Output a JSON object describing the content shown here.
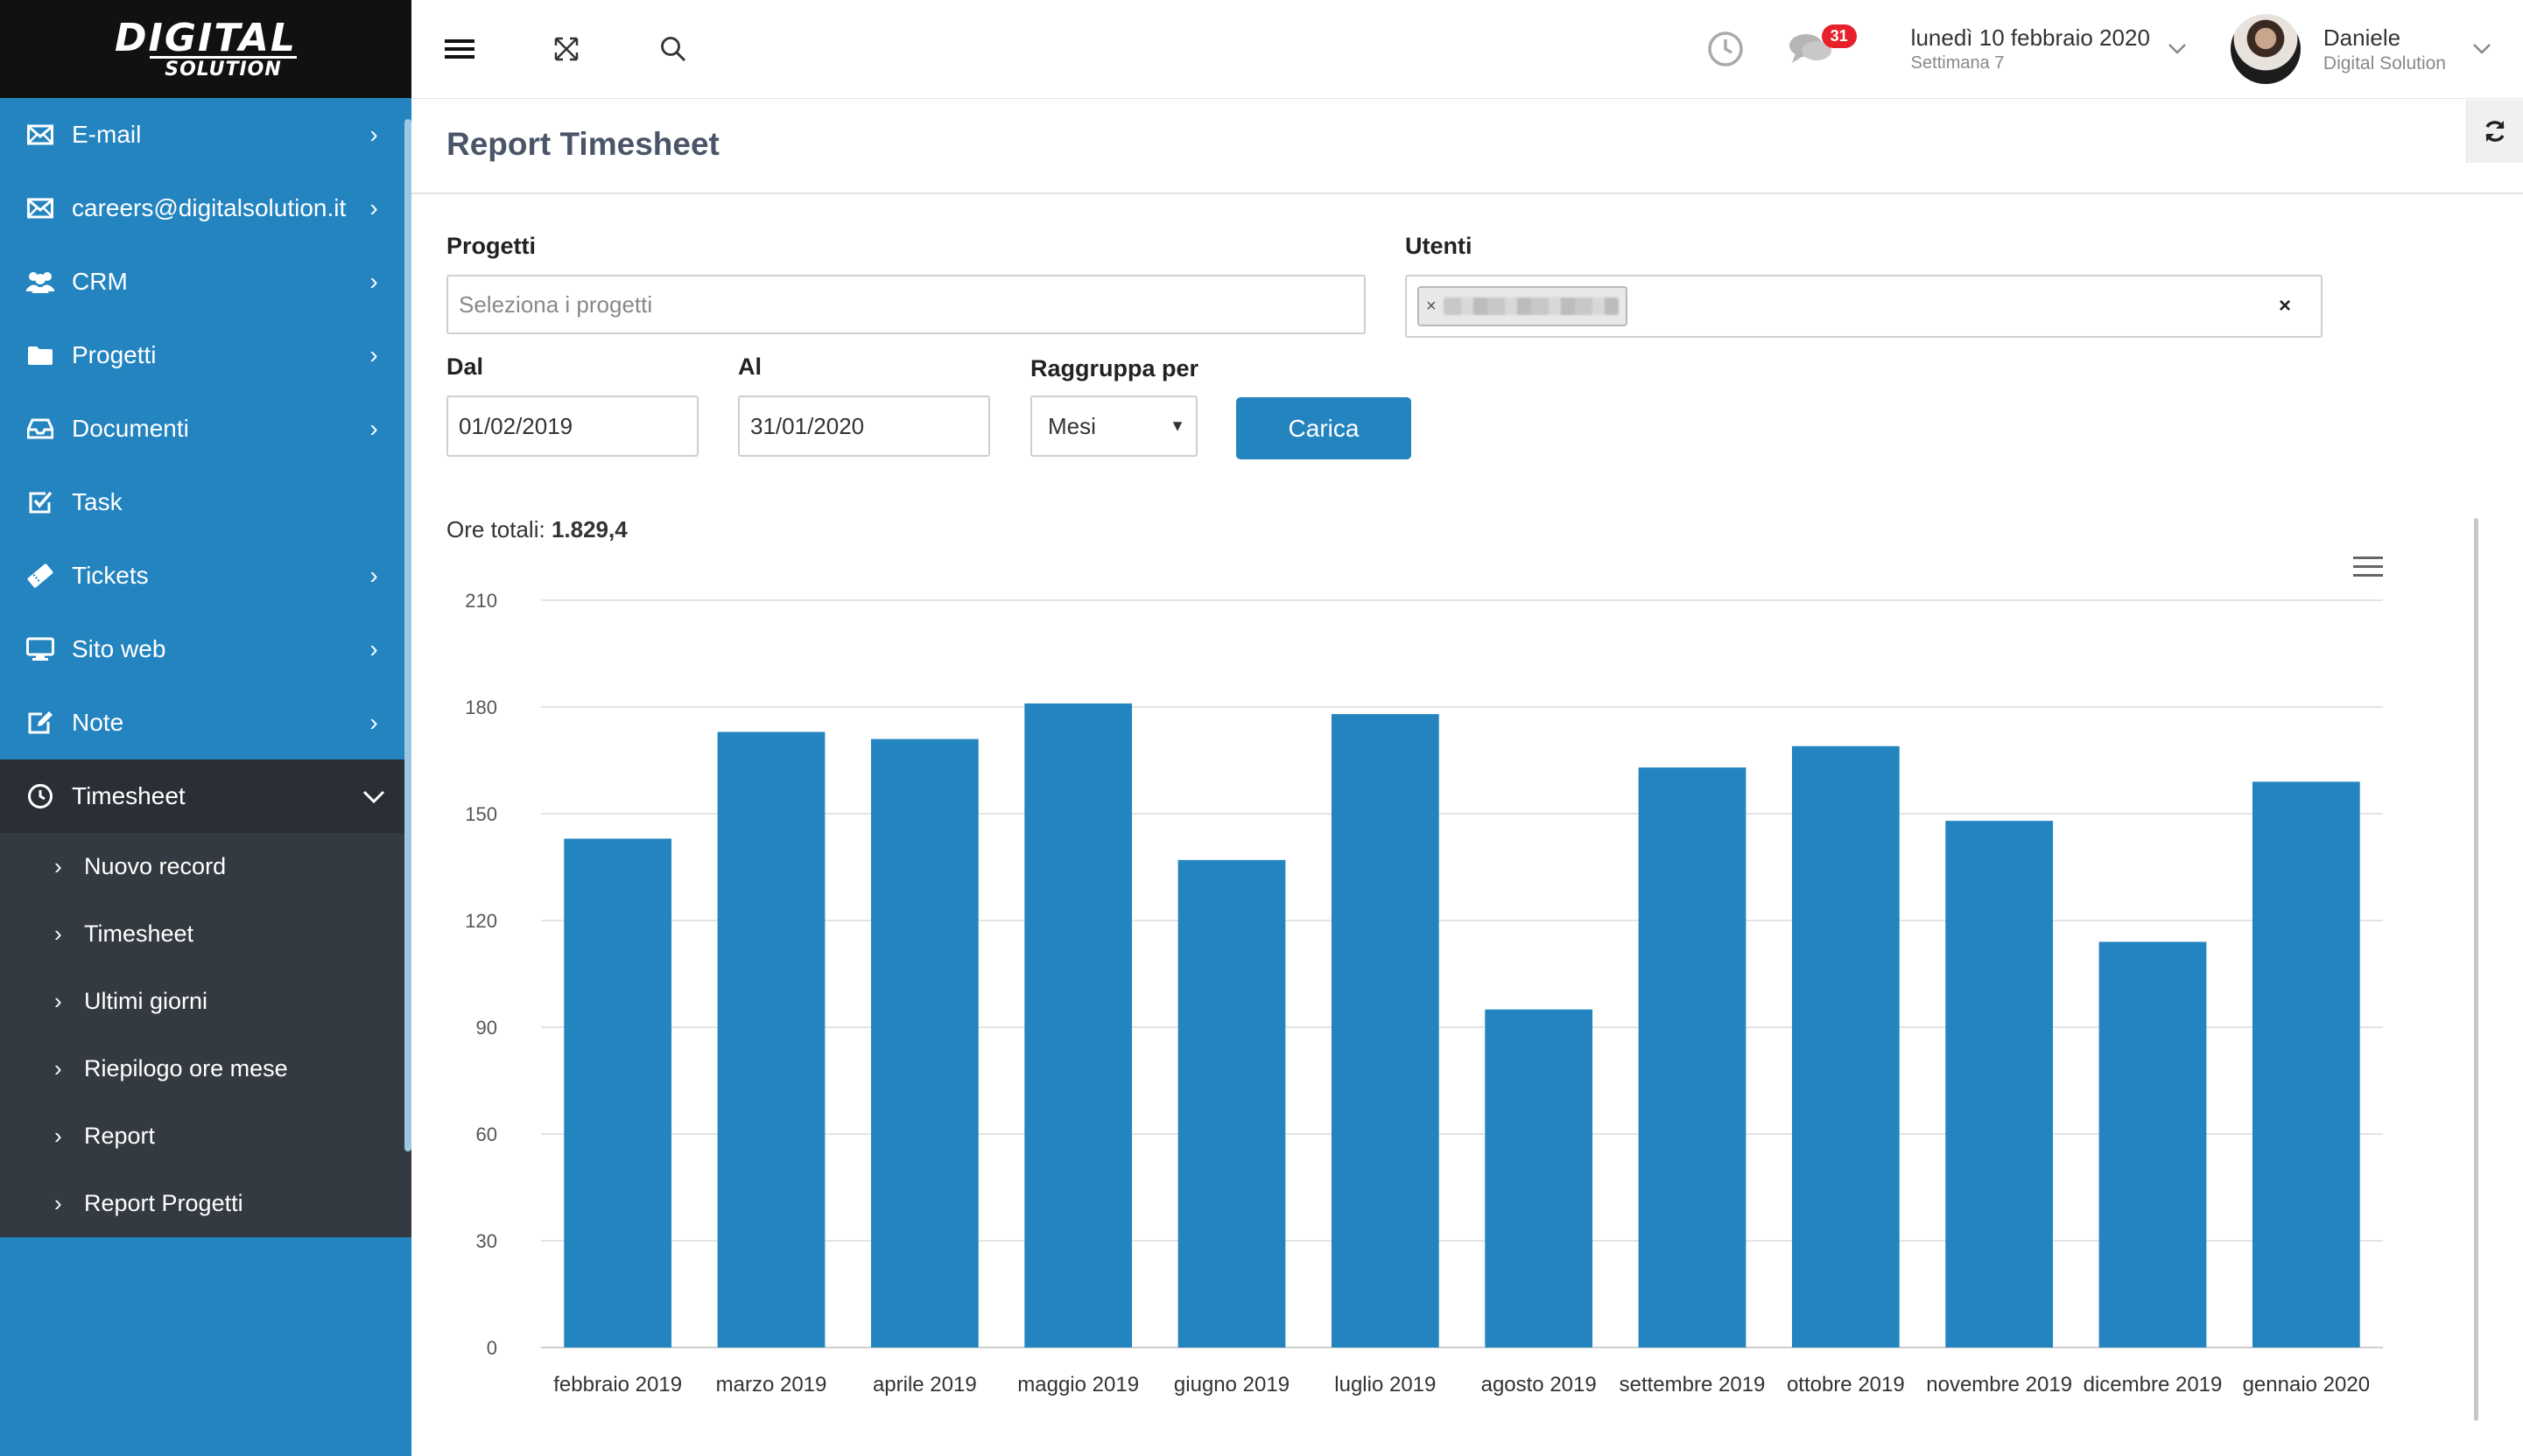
{
  "brand": {
    "logo_line1": "DIGITAL",
    "logo_line2": "SOLUTION"
  },
  "sidebar": {
    "items": [
      {
        "label": "E-mail",
        "icon": "envelope-icon"
      },
      {
        "label": "careers@digitalsolution.it",
        "icon": "envelope-icon"
      },
      {
        "label": "CRM",
        "icon": "users-icon"
      },
      {
        "label": "Progetti",
        "icon": "folder-icon"
      },
      {
        "label": "Documenti",
        "icon": "inbox-icon"
      },
      {
        "label": "Task",
        "icon": "checkbox-icon"
      },
      {
        "label": "Tickets",
        "icon": "ticket-icon"
      },
      {
        "label": "Sito web",
        "icon": "monitor-icon"
      },
      {
        "label": "Note",
        "icon": "edit-icon"
      },
      {
        "label": "Timesheet",
        "icon": "clock-icon"
      }
    ],
    "submenu": [
      {
        "label": "Nuovo record"
      },
      {
        "label": "Timesheet"
      },
      {
        "label": "Ultimi giorni"
      },
      {
        "label": "Riepilogo ore mese"
      },
      {
        "label": "Report"
      },
      {
        "label": "Report Progetti"
      }
    ]
  },
  "topbar": {
    "notifications_count": "31",
    "date": "lunedì 10 febbraio 2020",
    "week": "Settimana 7",
    "user_name": "Daniele",
    "user_company": "Digital Solution"
  },
  "page": {
    "title": "Report Timesheet"
  },
  "form": {
    "progetti_label": "Progetti",
    "progetti_placeholder": "Seleziona i progetti",
    "utenti_label": "Utenti",
    "dal_label": "Dal",
    "dal_value": "01/02/2019",
    "al_label": "Al",
    "al_value": "31/01/2020",
    "raggruppa_label": "Raggruppa per",
    "raggruppa_value": "Mesi",
    "submit_label": "Carica"
  },
  "summary": {
    "label": "Ore totali:",
    "value": "1.829,4"
  },
  "colors": {
    "sidebar": "#2384c0",
    "sidebar_active": "#2a2f36",
    "submenu": "#343a41",
    "bar": "#2384c0",
    "badge": "#e8202a"
  },
  "chart_data": {
    "type": "bar",
    "categories": [
      "febbraio 2019",
      "marzo 2019",
      "aprile 2019",
      "maggio 2019",
      "giugno 2019",
      "luglio 2019",
      "agosto 2019",
      "settembre 2019",
      "ottobre 2019",
      "novembre 2019",
      "dicembre 2019",
      "gennaio 2020"
    ],
    "values": [
      143,
      173,
      171,
      181,
      137,
      178,
      95,
      163,
      169,
      148,
      114,
      159
    ],
    "yticks": [
      0,
      30,
      60,
      90,
      120,
      150,
      180,
      210
    ],
    "ylim": [
      0,
      210
    ],
    "grid": true,
    "legend": false
  }
}
